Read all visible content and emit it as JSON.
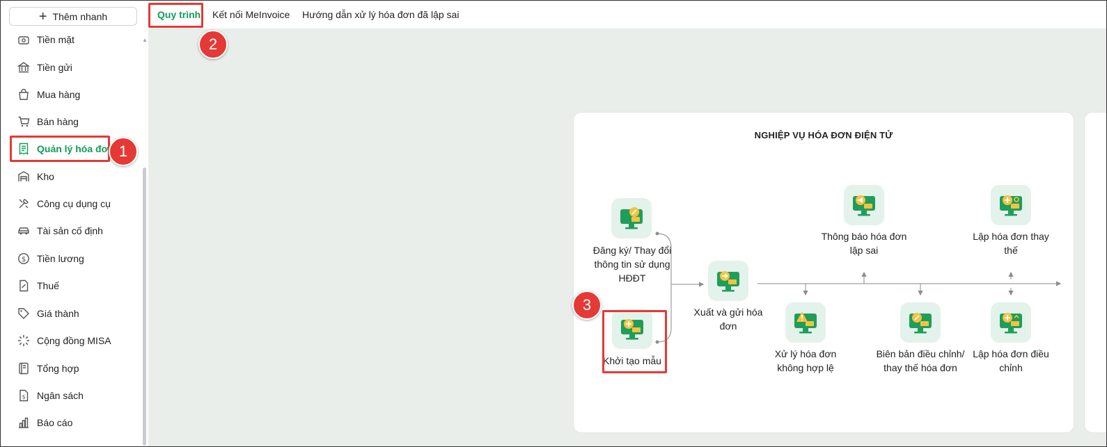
{
  "sidebar": {
    "quick_add_label": "Thêm nhanh",
    "items": [
      {
        "label": "Tiền mặt",
        "icon": "cash-register-icon"
      },
      {
        "label": "Tiền gửi",
        "icon": "bank-icon"
      },
      {
        "label": "Mua hàng",
        "icon": "shopping-bag-icon"
      },
      {
        "label": "Bán hàng",
        "icon": "cart-icon"
      },
      {
        "label": "Quản lý hóa đơn",
        "icon": "receipt-icon",
        "active": true
      },
      {
        "label": "Kho",
        "icon": "warehouse-icon"
      },
      {
        "label": "Công cụ dụng cụ",
        "icon": "tools-icon"
      },
      {
        "label": "Tài sản cố định",
        "icon": "car-icon"
      },
      {
        "label": "Tiền lương",
        "icon": "dollar-icon"
      },
      {
        "label": "Thuế",
        "icon": "tax-document-icon"
      },
      {
        "label": "Giá thành",
        "icon": "price-tag-icon"
      },
      {
        "label": "Cộng đồng MISA",
        "icon": "community-icon"
      },
      {
        "label": "Tổng hợp",
        "icon": "ledger-icon"
      },
      {
        "label": "Ngân sách",
        "icon": "budget-icon"
      },
      {
        "label": "Báo cáo",
        "icon": "bar-chart-icon"
      }
    ]
  },
  "tabs": [
    {
      "label": "Quy trình",
      "active": true
    },
    {
      "label": "Kết nối MeInvoice"
    },
    {
      "label": "Hướng dẫn xử lý hóa đơn đã lập sai"
    }
  ],
  "workflow": {
    "title": "NGHIỆP VỤ HÓA ĐƠN ĐIỆN TỬ",
    "nodes": {
      "register": "Đăng ký/ Thay đổi thông tin sử dụng HĐĐT",
      "create_template": "Khởi tạo mẫu",
      "issue_send": "Xuất và gửi hóa đơn",
      "notify_wrong": "Thông báo hóa đơn lập sai",
      "handle_invalid": "Xử lý hóa đơn không hợp lệ",
      "adjust_record": "Biên bản điều chỉnh/ thay thế hóa đơn",
      "replace_invoice": "Lập hóa đơn thay thế",
      "adjust_invoice": "Lập hóa đơn điều chỉnh"
    }
  },
  "callouts": [
    "1",
    "2",
    "3"
  ],
  "colors": {
    "accent": "#0f9d58",
    "highlight": "#e53935",
    "node_bg": "#e3f2ea",
    "content_bg": "#e9eeeb"
  }
}
